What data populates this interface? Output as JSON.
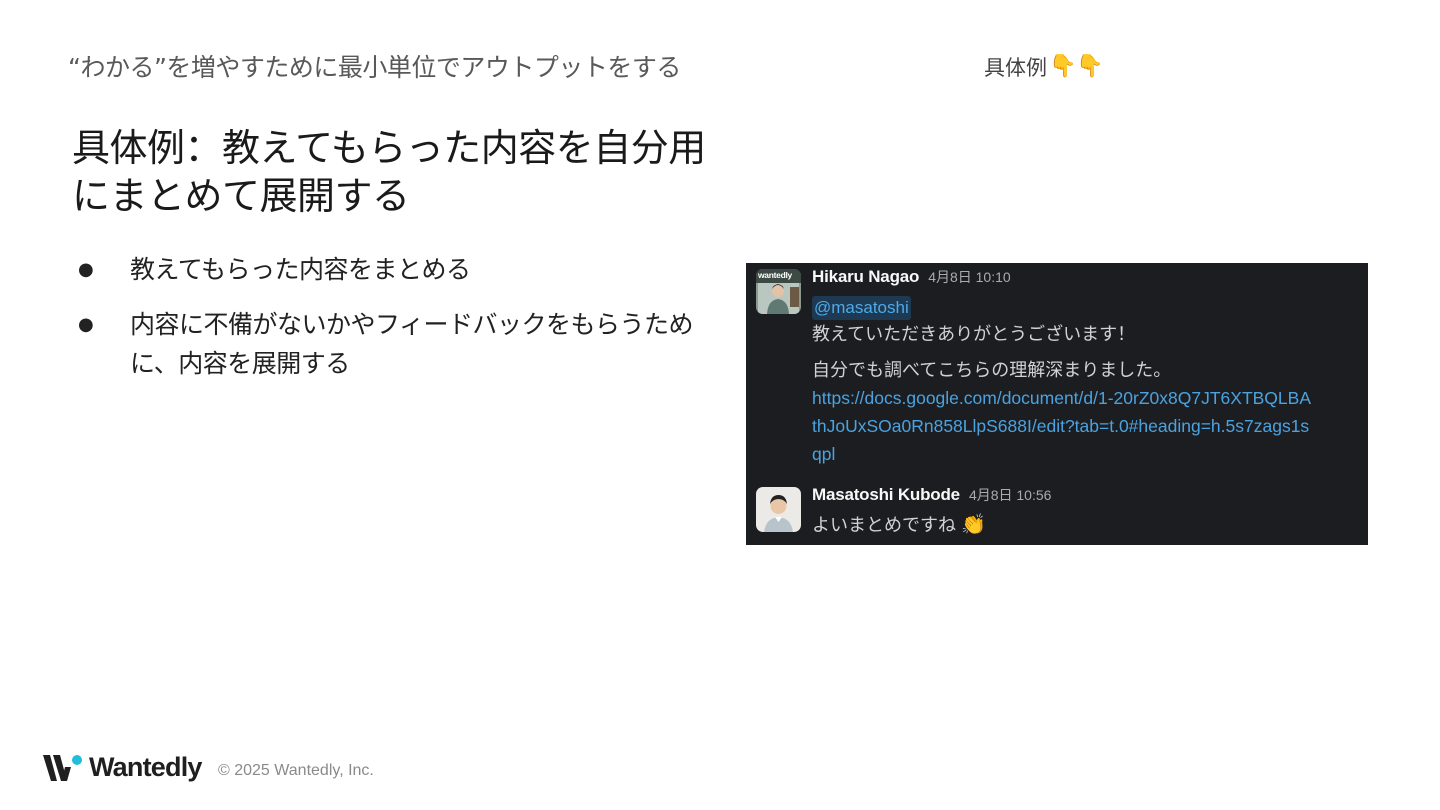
{
  "header": {
    "section_title": "“わかる”を増やすために最小単位でアウトプットをする",
    "example_label": "具体例",
    "pointer_emoji": "👇👇"
  },
  "main": {
    "title": "具体例：教えてもらった内容を自分用にまとめて展開する",
    "bullets": [
      "教えてもらった内容をまとめる",
      "内容に不備がないかやフィードバックをもらうために、内容を展開する"
    ],
    "bullet_glyph": "●"
  },
  "slack": {
    "messages": [
      {
        "author": "Hikaru Nagao",
        "time": "4月8日 10:10",
        "mention": "@masatoshi",
        "line1": "教えていただきありがとうございます！",
        "line2": "自分でも調べてこちらの理解深まりました。",
        "link": "https://docs.google.com/document/d/1-20rZ0x8Q7JT6XTBQLBAthJoUxSOa0Rn858LlpS688I/edit?tab=t.0#heading=h.5s7zags1sqpl",
        "avatar_text": "wantedly"
      },
      {
        "author": "Masatoshi Kubode",
        "time": "4月8日 10:56",
        "text": "よいまとめですね",
        "emoji": "👏"
      }
    ],
    "colors": {
      "background": "#1c1d21",
      "link": "#4aa3e0",
      "mention_bg": "#1d3a52"
    }
  },
  "footer": {
    "brand": "Wantedly",
    "copyright": "© 2025 Wantedly, Inc.",
    "brand_accent": "#21bddb"
  }
}
